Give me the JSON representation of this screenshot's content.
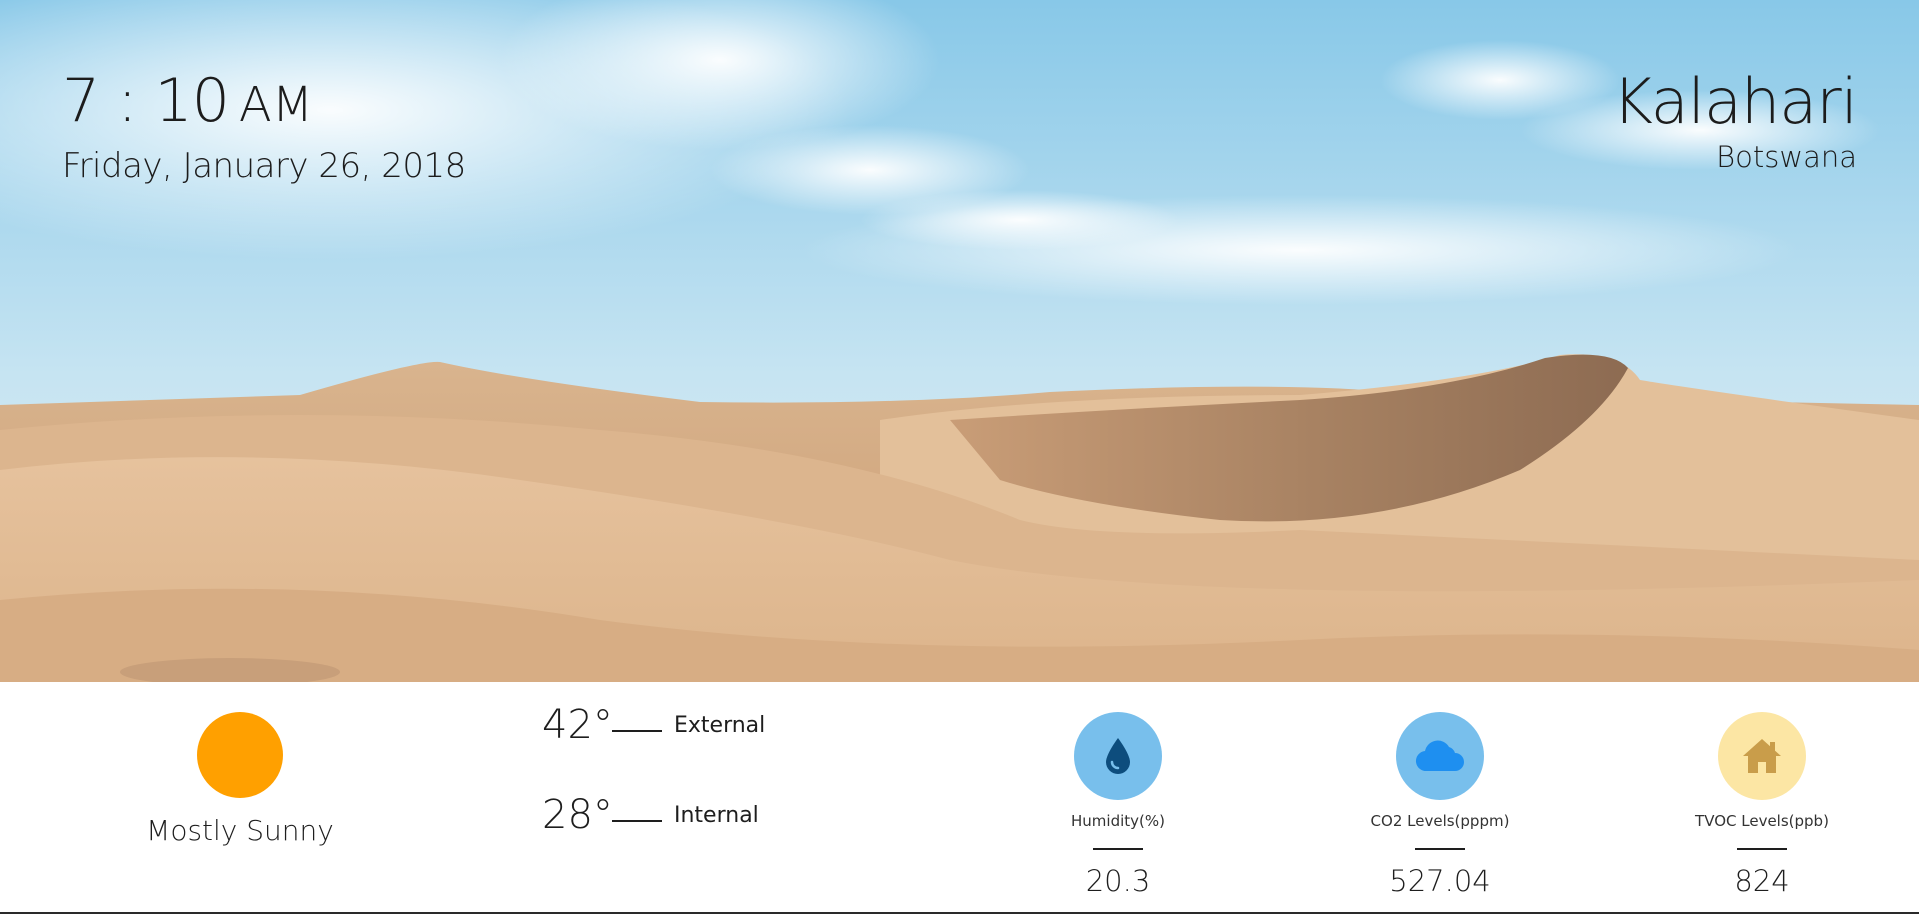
{
  "header": {
    "time": "7 : 10",
    "ampm": "AM",
    "date": "Friday, January 26, 2018",
    "place": "Kalahari",
    "region": "Botswana"
  },
  "weather": {
    "icon": "sun-icon",
    "icon_color": "#ffa000",
    "condition": "Mostly Sunny"
  },
  "temperatures": [
    {
      "value": "42°",
      "label": "External"
    },
    {
      "value": "28°",
      "label": "Internal"
    }
  ],
  "sensors": [
    {
      "icon": "water-drop-icon",
      "label": "Humidity(%)",
      "value": "20.3",
      "circle_color": "#78bfec",
      "icon_color": "#0d4d7d"
    },
    {
      "icon": "cloud-icon",
      "label": "CO2 Levels(pppm)",
      "value": "527.04",
      "circle_color": "#78bfec",
      "icon_color": "#1e8ff0"
    },
    {
      "icon": "house-icon",
      "label": "TVOC Levels(ppb)",
      "value": "824",
      "circle_color": "#fce6a4",
      "icon_color": "#c99d4a"
    }
  ]
}
